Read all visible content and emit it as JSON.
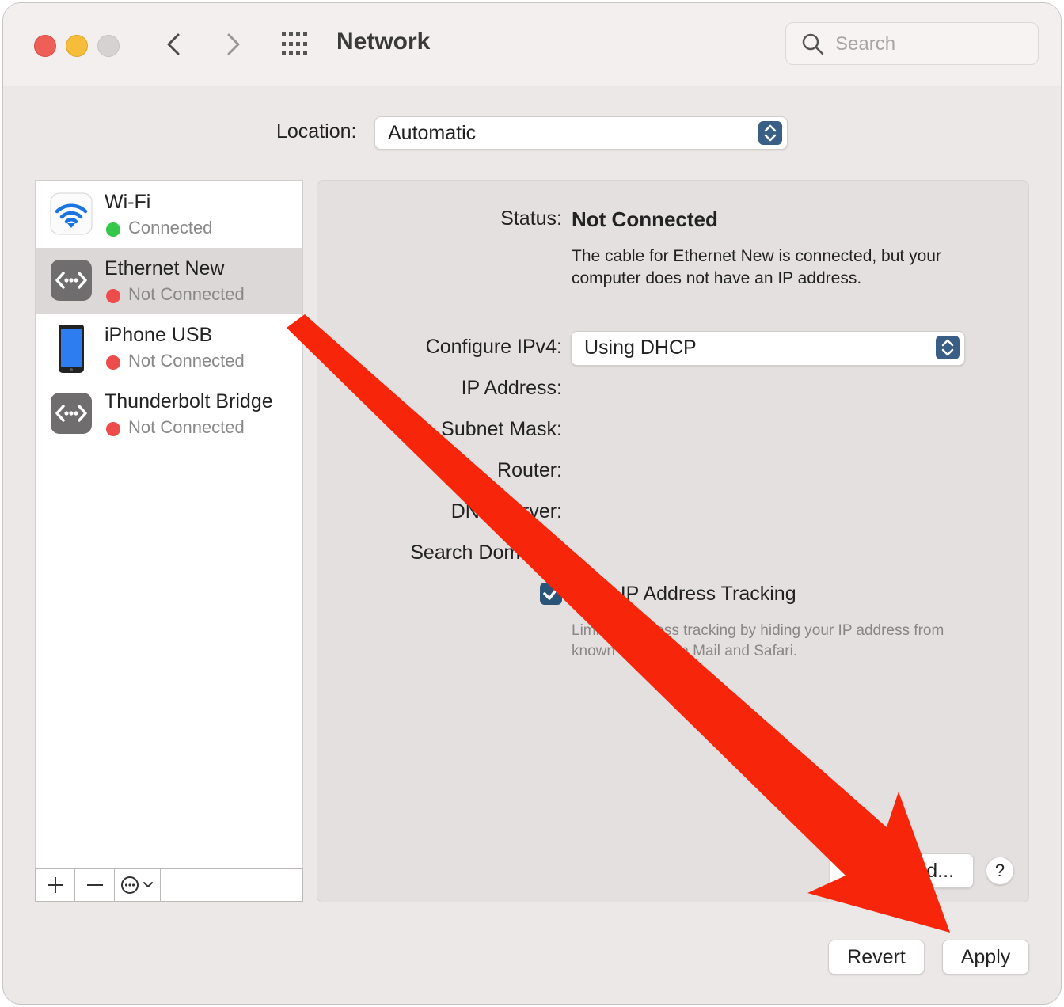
{
  "window": {
    "title": "Network",
    "search_placeholder": "Search"
  },
  "location": {
    "label": "Location:",
    "value": "Automatic"
  },
  "services": [
    {
      "name": "Wi-Fi",
      "status": "Connected",
      "status_color": "#34c84a",
      "icon": "wifi-icon"
    },
    {
      "name": "Ethernet New",
      "status": "Not Connected",
      "status_color": "#ee4b4b",
      "icon": "ethernet-icon",
      "selected": true
    },
    {
      "name": "iPhone USB",
      "status": "Not Connected",
      "status_color": "#ee4b4b",
      "icon": "iphone-icon"
    },
    {
      "name": "Thunderbolt Bridge",
      "status": "Not Connected",
      "status_color": "#ee4b4b",
      "icon": "thunderbolt-bridge-icon"
    }
  ],
  "sidebar_tools": [
    "add-icon",
    "remove-icon",
    "more-options-icon"
  ],
  "detail": {
    "status_label": "Status:",
    "status_value": "Not Connected",
    "status_description": "The cable for Ethernet New is connected, but your computer does not have an IP address.",
    "configure_label": "Configure IPv4:",
    "configure_value": "Using DHCP",
    "ip_label": "IP Address:",
    "subnet_label": "Subnet Mask:",
    "router_label": "Router:",
    "dns_label": "DNS Server:",
    "search_domains_label": "Search Domains:",
    "limit_tracking_label": "Limit IP Address Tracking",
    "limit_tracking_checked": true,
    "limit_tracking_description": "Limit IP address tracking by hiding your IP address from known trackers in Mail and Safari.",
    "advanced_label": "Advanced...",
    "help_label": "?"
  },
  "footer": {
    "revert_label": "Revert",
    "apply_label": "Apply"
  },
  "colors": {
    "accent": "#2b5479",
    "annotation_arrow": "#f7260b"
  }
}
